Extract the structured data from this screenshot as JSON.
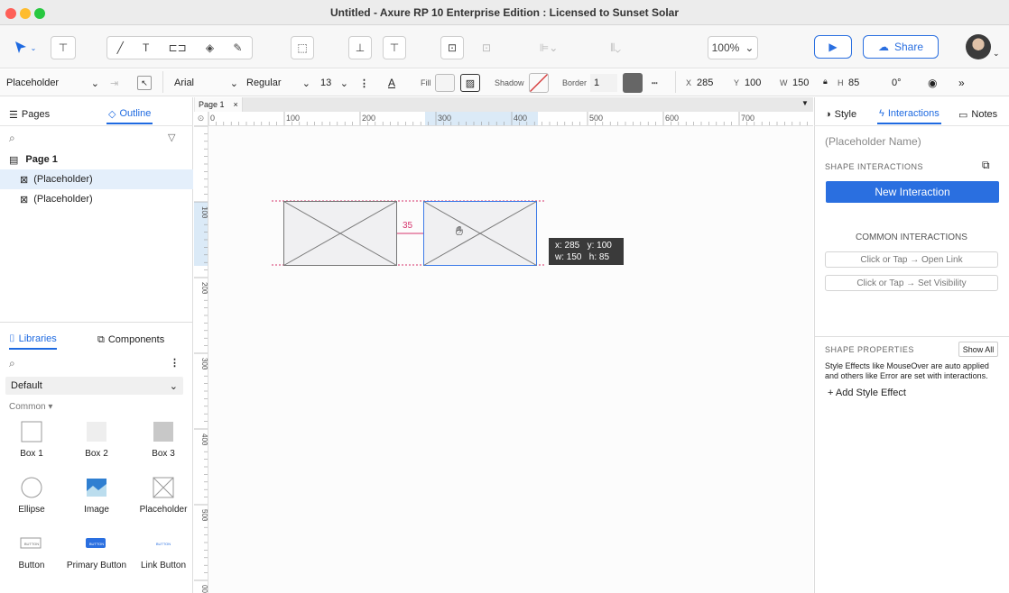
{
  "window": {
    "title": "Untitled - Axure RP 10 Enterprise Edition : Licensed to Sunset Solar"
  },
  "toolbar": {
    "zoom": "100%",
    "share_label": "Share"
  },
  "propbar": {
    "widget_type": "Placeholder",
    "font": "Arial",
    "weight": "Regular",
    "size": "13",
    "fill_label": "Fill",
    "shadow_label": "Shadow",
    "border_label": "Border",
    "border_value": "1",
    "x_label": "X",
    "x": "285",
    "y_label": "Y",
    "y": "100",
    "w_label": "W",
    "w": "150",
    "h_label": "H",
    "h": "85",
    "rotation": "0°"
  },
  "left": {
    "tabs": [
      "Pages",
      "Outline"
    ],
    "page": "Page 1",
    "items": [
      "(Placeholder)",
      "(Placeholder)"
    ],
    "lib_tabs": [
      "Libraries",
      "Components"
    ],
    "library": "Default",
    "group": "Common",
    "widgets": [
      {
        "label": "Box 1",
        "icon": "box1"
      },
      {
        "label": "Box 2",
        "icon": "box2"
      },
      {
        "label": "Box 3",
        "icon": "box3"
      },
      {
        "label": "Ellipse",
        "icon": "ellipse"
      },
      {
        "label": "Image",
        "icon": "image"
      },
      {
        "label": "Placeholder",
        "icon": "placeholder"
      },
      {
        "label": "Button",
        "icon": "button"
      },
      {
        "label": "Primary Button",
        "icon": "primary-button"
      },
      {
        "label": "Link Button",
        "icon": "link-button"
      }
    ],
    "button_icon_text": "BUTTON"
  },
  "canvas": {
    "tab": "Page 1",
    "ruler_top": [
      "0",
      "100",
      "200",
      "300",
      "400",
      "500",
      "600",
      "700"
    ],
    "ruler_left": [
      "100",
      "200",
      "300",
      "400",
      "500",
      "00"
    ],
    "gap": "35",
    "tooltip_line1": "x: 285   y: 100",
    "tooltip_line2": "w: 150   h: 85"
  },
  "right": {
    "tabs": [
      "Style",
      "Interactions",
      "Notes"
    ],
    "name_placeholder": "(Placeholder Name)",
    "shape_interactions": "SHAPE INTERACTIONS",
    "new_interaction": "New Interaction",
    "common": "COMMON INTERACTIONS",
    "common_items": [
      "Click or Tap → Open Link",
      "Click or Tap → Set Visibility"
    ],
    "shape_props": "SHAPE PROPERTIES",
    "show_all": "Show All",
    "props_desc": "Style Effects like MouseOver are auto applied and others like Error are set with interactions.",
    "add_style": "+ Add Style Effect"
  },
  "colors": {
    "accent": "#1e6ae1",
    "primary_btn": "#2a6fe0",
    "guide": "#d6336c"
  }
}
